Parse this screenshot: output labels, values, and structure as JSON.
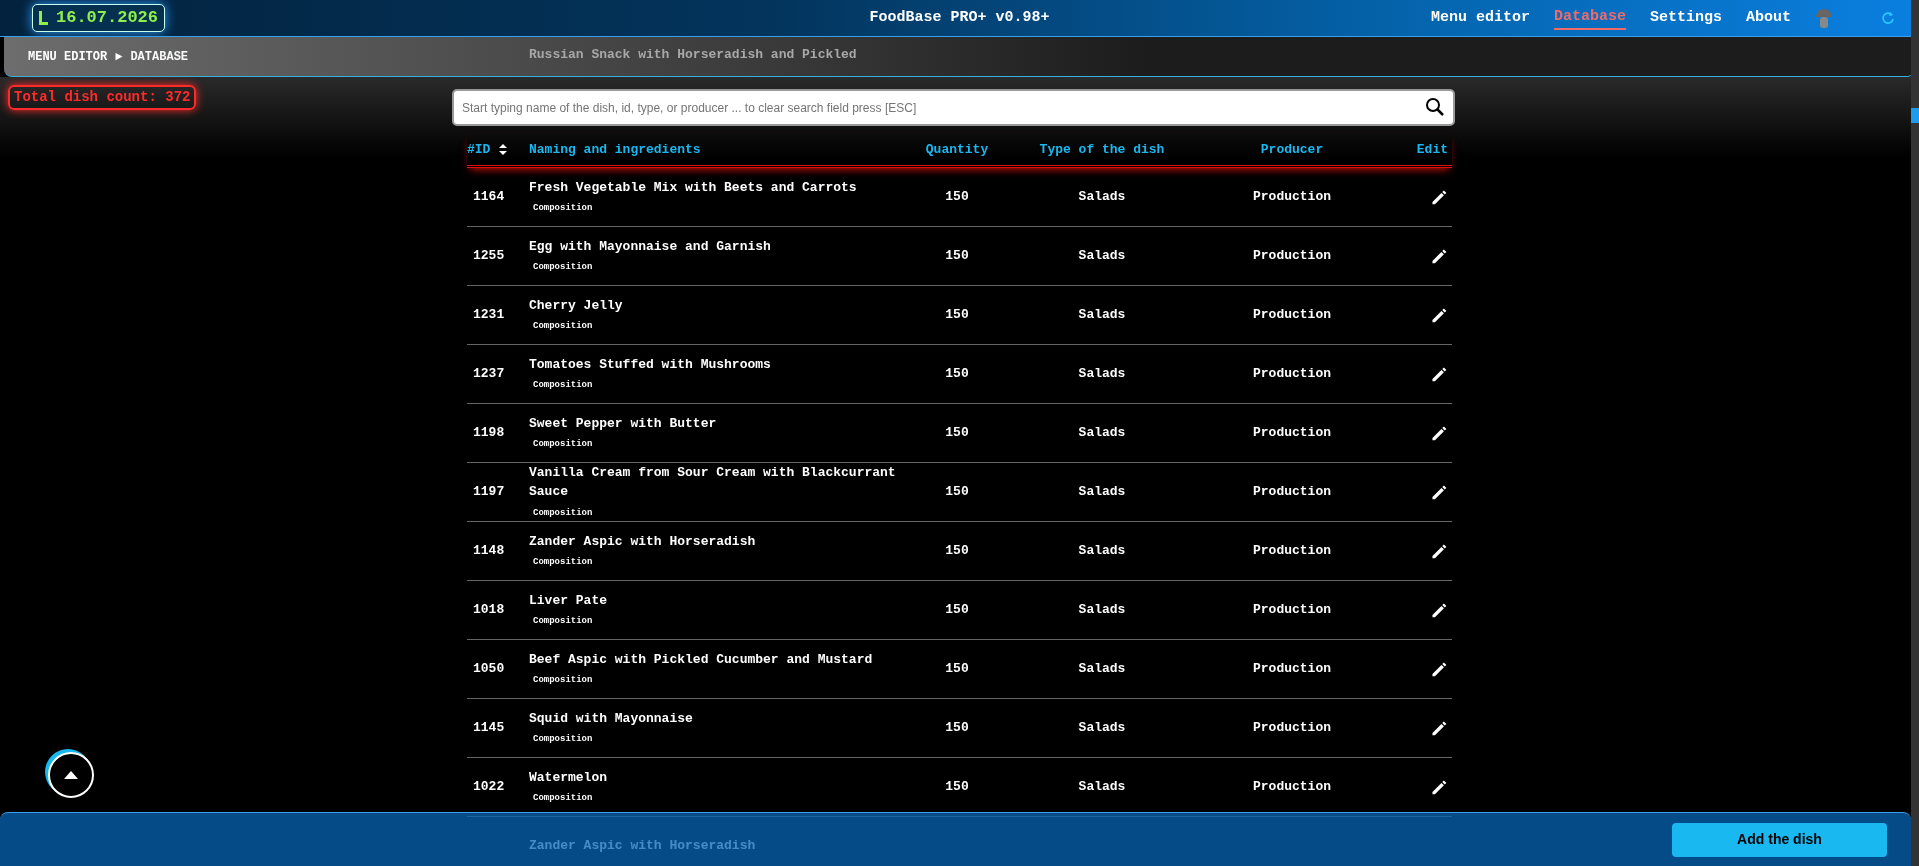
{
  "header": {
    "date": "16.07.2026",
    "title": "FoodBase PRO+ v0.98+",
    "nav": [
      {
        "label": "Menu editor",
        "selected": false
      },
      {
        "label": "Database",
        "selected": true
      },
      {
        "label": "Settings",
        "selected": false
      },
      {
        "label": "About",
        "selected": false
      }
    ]
  },
  "breadcrumb": {
    "items": [
      "MENU EDITOR",
      "DATABASE"
    ],
    "separator": "►",
    "scrolled_behind_text": "Russian Snack with Horseradish and Pickled"
  },
  "total_count": "Total dish count: 372",
  "search": {
    "placeholder": "Start typing name of the dish, id, type, or producer ... to clear search field press [ESC]"
  },
  "table": {
    "columns": [
      "#ID",
      "Naming and ingredients",
      "Quantity",
      "Type of the dish",
      "Producer",
      "Edit"
    ],
    "rows": [
      {
        "id": "1164",
        "name": "Fresh Vegetable Mix with Beets and Carrots",
        "link": "Composition",
        "quantity": "150",
        "type": "Salads",
        "producer": "Production"
      },
      {
        "id": "1255",
        "name": "Egg with Mayonnaise and Garnish",
        "link": "Composition",
        "quantity": "150",
        "type": "Salads",
        "producer": "Production"
      },
      {
        "id": "1231",
        "name": "Cherry Jelly",
        "link": "Composition",
        "quantity": "150",
        "type": "Salads",
        "producer": "Production"
      },
      {
        "id": "1237",
        "name": "Tomatoes Stuffed with Mushrooms",
        "link": "Composition",
        "quantity": "150",
        "type": "Salads",
        "producer": "Production"
      },
      {
        "id": "1198",
        "name": "Sweet Pepper with Butter",
        "link": "Composition",
        "quantity": "150",
        "type": "Salads",
        "producer": "Production"
      },
      {
        "id": "1197",
        "name": "Vanilla Cream from Sour Cream with Blackcurrant Sauce",
        "link": "Composition",
        "quantity": "150",
        "type": "Salads",
        "producer": "Production"
      },
      {
        "id": "1148",
        "name": "Zander Aspic with Horseradish",
        "link": "Composition",
        "quantity": "150",
        "type": "Salads",
        "producer": "Production"
      },
      {
        "id": "1018",
        "name": "Liver Pate",
        "link": "Composition",
        "quantity": "150",
        "type": "Salads",
        "producer": "Production"
      },
      {
        "id": "1050",
        "name": "Beef Aspic with Pickled Cucumber and Mustard",
        "link": "Composition",
        "quantity": "150",
        "type": "Salads",
        "producer": "Production"
      },
      {
        "id": "1145",
        "name": "Squid with Mayonnaise",
        "link": "Composition",
        "quantity": "150",
        "type": "Salads",
        "producer": "Production"
      },
      {
        "id": "1022",
        "name": "Watermelon",
        "link": "Composition",
        "quantity": "150",
        "type": "Salads",
        "producer": "Production"
      },
      {
        "name": "Zander Aspic with Horseradish"
      }
    ]
  },
  "footer": {
    "button": "Add the dish"
  }
}
